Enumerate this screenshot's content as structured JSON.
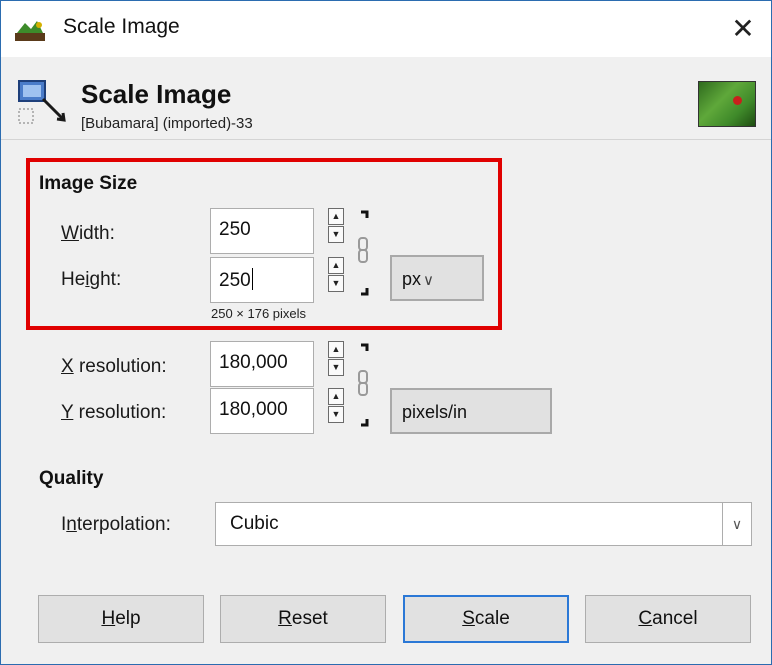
{
  "window": {
    "title": "Scale Image",
    "close_glyph": "✕"
  },
  "header": {
    "title": "Scale Image",
    "subtitle": "[Bubamara] (imported)-33"
  },
  "image_size": {
    "section_title": "Image Size",
    "width_label_ul": "W",
    "width_label_rest": "idth:",
    "width_value": "250",
    "height_label_pre": "He",
    "height_label_ul": "i",
    "height_label_rest": "ght:",
    "height_value": "250",
    "size_info": "250 × 176 pixels",
    "unit": "px",
    "unit_arrow": "∨"
  },
  "resolution": {
    "x_label_ul": "X",
    "x_label_rest": " resolution:",
    "x_value": "180,000",
    "y_label_ul": "Y",
    "y_label_rest": " resolution:",
    "y_value": "180,000",
    "unit": "pixels/in"
  },
  "quality": {
    "section_title": "Quality",
    "interp_label_pre": "I",
    "interp_label_ul": "n",
    "interp_label_rest": "terpolation:",
    "interp_value": "Cubic"
  },
  "buttons": {
    "help_ul": "H",
    "help_rest": "elp",
    "reset_ul": "R",
    "reset_rest": "eset",
    "scale_ul": "S",
    "scale_rest": "cale",
    "cancel_ul": "C",
    "cancel_rest": "ancel"
  },
  "icons": {
    "spin_up": "▲",
    "spin_down": "▼",
    "combo_arrow": "∨"
  },
  "colors": {
    "highlight_box": "#e00000",
    "default_button_border": "#2b78d6"
  }
}
